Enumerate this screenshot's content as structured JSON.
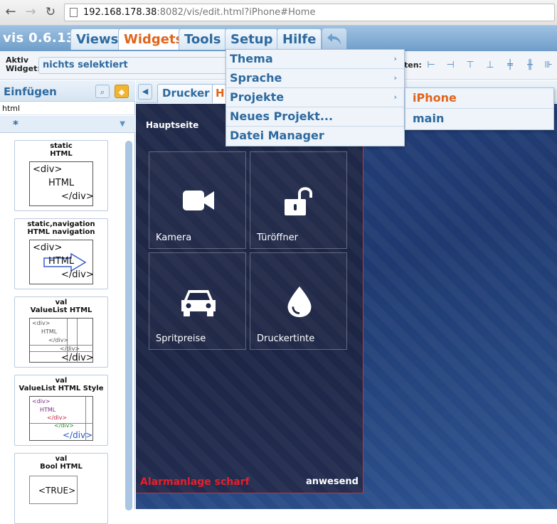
{
  "browser": {
    "back": "←",
    "forward": "→",
    "reload": "↻",
    "url_host": "192.168.178.38",
    "url_rest": ":8082/vis/edit.html?iPhone#Home"
  },
  "app": {
    "title": "vis 0.6.13",
    "tabs": [
      {
        "label": "Views"
      },
      {
        "label": "Widgets"
      },
      {
        "label": "Tools"
      },
      {
        "label": "Setup"
      },
      {
        "label": "Hilfe"
      }
    ]
  },
  "toolbar": {
    "aktiv_label_1": "Aktiv",
    "aktiv_label_2": "Widget:",
    "widget_value": "nichts selektiert",
    "align_label": "ten:"
  },
  "left_panel": {
    "title": "Einfügen",
    "filter_value": "html",
    "set_value": "*",
    "palette": [
      {
        "title_1": "static",
        "title_2": "HTML",
        "preview": [
          "<div>",
          "HTML",
          "</div>"
        ]
      },
      {
        "title_1": "static,navigation",
        "title_2": "HTML navigation",
        "preview": [
          "<div>",
          "HTML",
          "</div>"
        ]
      },
      {
        "title_1": "val",
        "title_2": "ValueList HTML",
        "preview": [
          "<div>",
          "HTML",
          "</div>",
          "</div>"
        ]
      },
      {
        "title_1": "val",
        "title_2": "ValueList HTML Style",
        "preview": [
          "<div>",
          "HTML",
          "</div>",
          "</div>",
          "</div>"
        ]
      },
      {
        "title_1": "val",
        "title_2": "Bool HTML",
        "preview": [
          "<TRUE>"
        ]
      }
    ]
  },
  "views": {
    "tabs": [
      {
        "label": "Drucker"
      },
      {
        "label": "H"
      }
    ]
  },
  "canvas": {
    "heading": "Hauptseite",
    "tiles": [
      {
        "label": "Kamera",
        "icon": "video-camera-icon"
      },
      {
        "label": "Türöffner",
        "icon": "unlock-icon"
      },
      {
        "label": "Spritpreise",
        "icon": "car-icon"
      },
      {
        "label": "Druckertinte",
        "icon": "ink-drop-icon"
      }
    ],
    "alarm": "Alarmanlage scharf",
    "presence": "anwesend"
  },
  "setup_menu": {
    "items": [
      {
        "label": "Thema",
        "has_sub": true
      },
      {
        "label": "Sprache",
        "has_sub": true
      },
      {
        "label": "Projekte",
        "has_sub": true
      },
      {
        "label": "Neues Projekt...",
        "has_sub": false
      },
      {
        "label": "Datei Manager",
        "has_sub": false
      }
    ],
    "projects": [
      {
        "label": "iPhone",
        "current": true
      },
      {
        "label": "main",
        "current": false
      }
    ]
  },
  "colors": {
    "accent_orange": "#e0651c",
    "accent_blue": "#2e6a9e",
    "alarm_red": "#e81e2a"
  }
}
